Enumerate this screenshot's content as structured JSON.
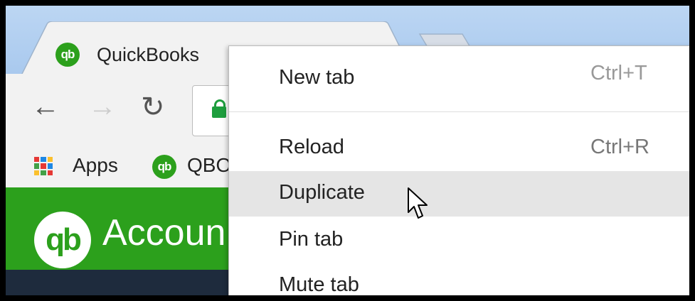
{
  "browser": {
    "tab": {
      "title": "QuickBooks",
      "favicon": "qb",
      "close": "×"
    },
    "toolbar": {
      "back_icon": "←",
      "forward_icon": "→",
      "reload_icon": "↻"
    },
    "bookmarks": [
      {
        "label": "Apps",
        "icon": "apps-grid-icon"
      },
      {
        "label": "QBO",
        "icon": "qb-icon"
      }
    ]
  },
  "page": {
    "logo": "qb",
    "brand": "Accoun"
  },
  "context_menu": {
    "items": [
      {
        "label": "New tab",
        "shortcut": "Ctrl+T"
      },
      {
        "label": "Reload",
        "shortcut": "Ctrl+R"
      },
      {
        "label": "Duplicate",
        "shortcut": ""
      },
      {
        "label": "Pin tab",
        "shortcut": ""
      },
      {
        "label": "Mute tab",
        "shortcut": ""
      }
    ],
    "hovered_item": "Duplicate"
  },
  "colors": {
    "qb_green": "#2ca01c",
    "tabstrip": "#bcd6f3",
    "navbar": "#1e2b3d",
    "hover": "#e5e5e5"
  }
}
